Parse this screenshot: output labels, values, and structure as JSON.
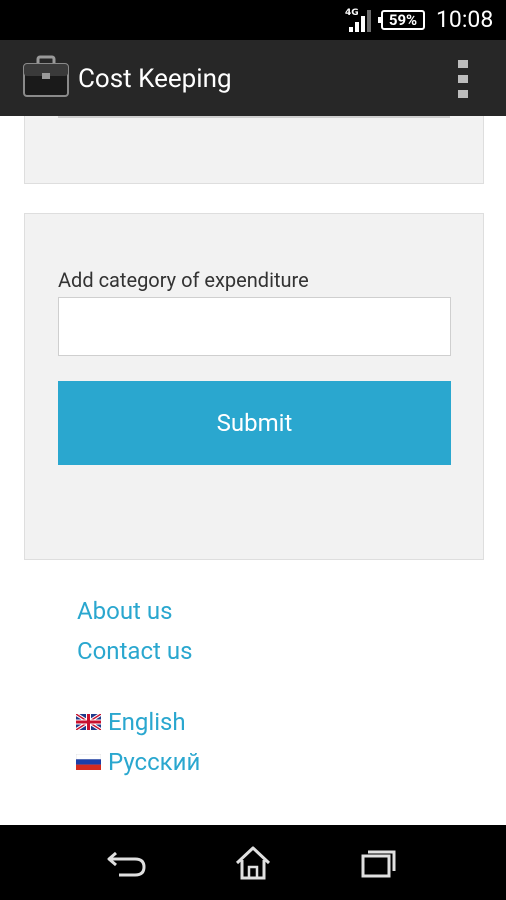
{
  "status_bar": {
    "network": "4G",
    "battery": "59%",
    "time": "10:08"
  },
  "app_bar": {
    "title": "Cost Keeping",
    "icons": {
      "app": "briefcase-icon",
      "menu": "overflow-menu-icon"
    }
  },
  "form": {
    "label": "Add category of expenditure",
    "input_value": "",
    "input_placeholder": "",
    "submit_label": "Submit"
  },
  "links": {
    "about": "About us",
    "contact": "Contact us"
  },
  "languages": [
    {
      "label": "English",
      "flag": "uk-flag-icon"
    },
    {
      "label": "Русский",
      "flag": "russia-flag-icon"
    }
  ],
  "nav_bar": {
    "icons": [
      "back-icon",
      "home-icon",
      "recent-apps-icon"
    ]
  },
  "colors": {
    "accent": "#2aa7cf",
    "app_bar": "#272727",
    "card_bg": "#f2f2f2"
  }
}
